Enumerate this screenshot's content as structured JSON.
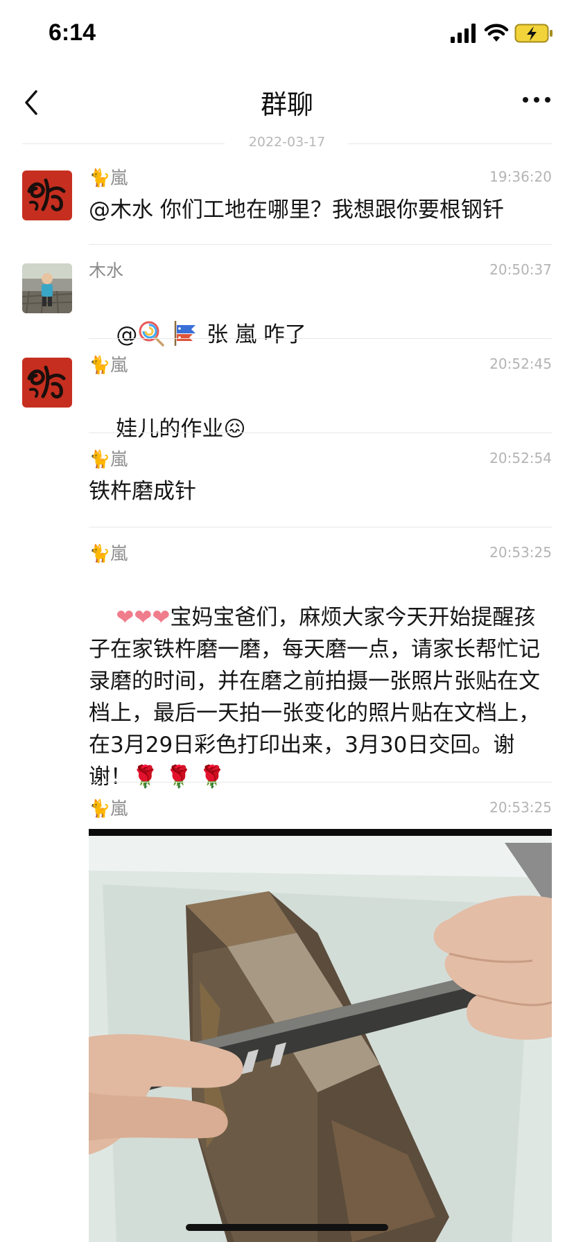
{
  "status_bar": {
    "time": "6:14"
  },
  "nav": {
    "title": "群聊"
  },
  "date_divider": "2022-03-17",
  "messages": [
    {
      "sender": "🐈嵐",
      "time": "19:36:20",
      "text": "@木水 你们工地在哪里？我想跟你要根钢钎"
    },
    {
      "sender": "木水",
      "time": "20:50:37",
      "text_prefix": "@",
      "text_suffix": " 张 嵐 咋了",
      "icons": [
        "lollipop-emoji",
        "carp-streamer-emoji"
      ]
    },
    {
      "sender": "🐈嵐",
      "time": "20:52:45",
      "text": "娃儿的作业",
      "emoji": "😖"
    },
    {
      "sender": "🐈嵐",
      "time": "20:52:54",
      "text": "铁杵磨成针"
    },
    {
      "sender": "🐈嵐",
      "time": "20:53:25",
      "text_hearts": "❤❤❤",
      "text": "宝妈宝爸们，麻烦大家今天开始提醒孩子在家铁杵磨一磨，每天磨一点，请家长帮忙记录磨的时间，并在磨之前拍摄一张照片张贴在文档上，最后一天拍一张变化的照片贴在文档上，在3月29日彩色打印出来，3月30日交回。谢谢！",
      "roses": "🌹 🌹 🌹"
    },
    {
      "sender": "🐈嵐",
      "time": "20:53:25",
      "image": "photo-iron-rod-on-whetstone"
    }
  ],
  "colors": {
    "avatar_red": "#c62f1f",
    "separator": "#e8e8e8",
    "meta_gray": "#b4b4b4"
  }
}
